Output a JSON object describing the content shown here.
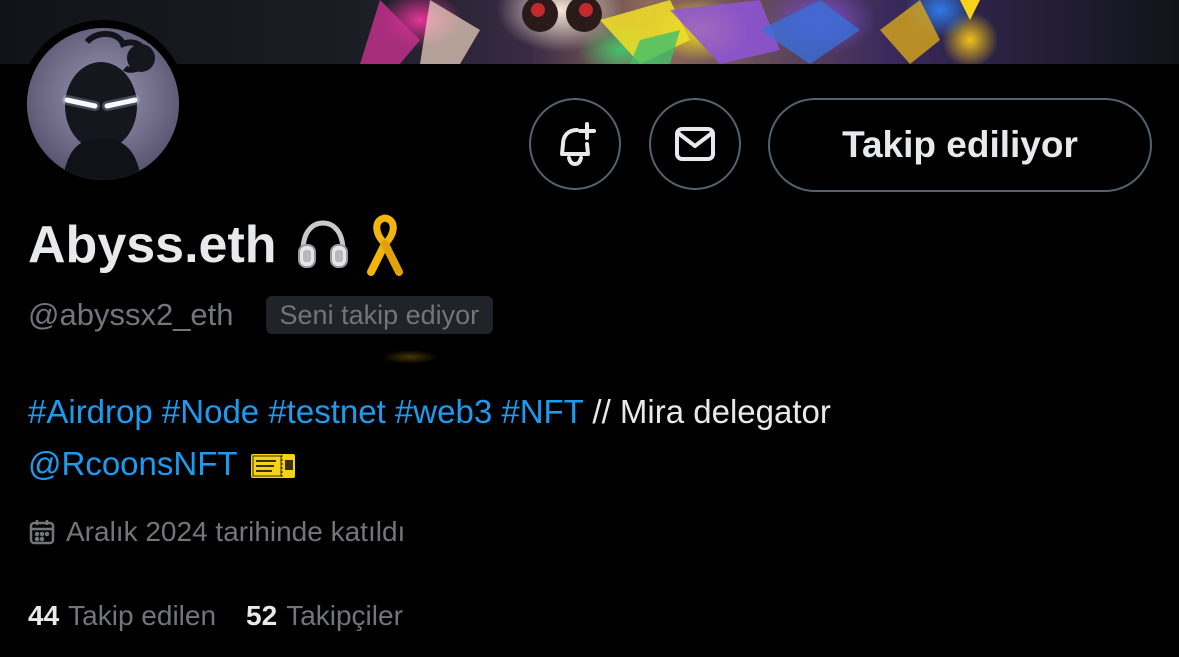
{
  "profile": {
    "display_name": "Abyss.eth",
    "name_emojis": [
      "headphones-emoji",
      "ribbon-emoji"
    ],
    "handle": "@abyssx2_eth",
    "follows_you_badge": "Seni takip ediyor",
    "bio": {
      "tags": [
        "#Airdrop",
        "#Node",
        "#testnet",
        "#web3",
        "#NFT"
      ],
      "text_after_tags": " // Mira delegator",
      "mention": "@RcoonsNFT",
      "trailing_emoji": "ticket-emoji"
    },
    "joined": "Aralık 2024 tarihinde katıldı",
    "following_count": "44",
    "following_label": "Takip edilen",
    "followers_count": "52",
    "followers_label": "Takipçiler"
  },
  "actions": {
    "notify_icon": "bell-plus-icon",
    "message_icon": "mail-icon",
    "follow_label": "Takip ediliyor"
  },
  "colors": {
    "background": "#000000",
    "text_primary": "#e7e9ea",
    "text_secondary": "#71767b",
    "link": "#1d9bf0",
    "border": "#536471",
    "badge_bg": "#202327"
  }
}
